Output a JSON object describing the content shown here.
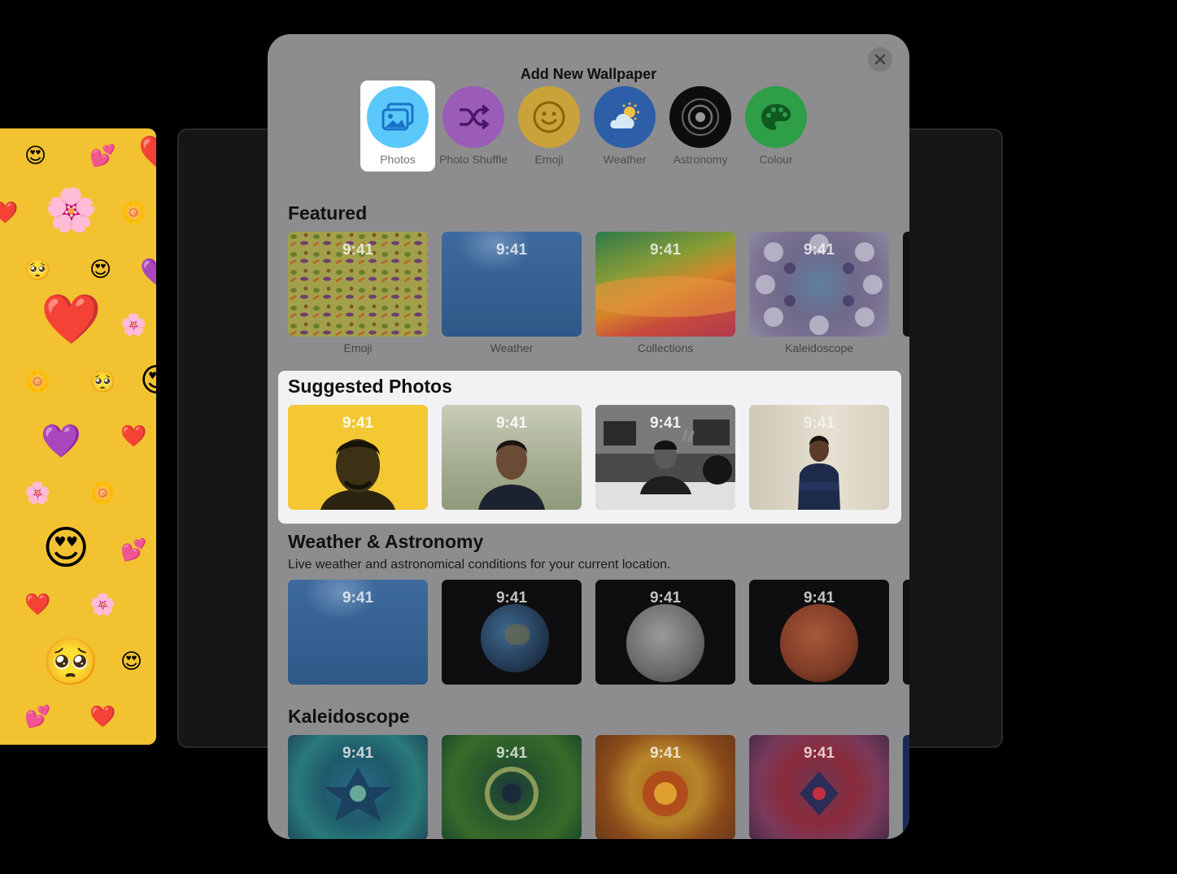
{
  "modal": {
    "title": "Add New Wallpaper",
    "close_icon": "close-icon"
  },
  "categories": [
    {
      "label": "Photos",
      "icon": "photos-icon",
      "color": "#5ac8fa",
      "selected": true
    },
    {
      "label": "Photo Shuffle",
      "icon": "shuffle-icon",
      "color": "#9b59b6",
      "selected": false
    },
    {
      "label": "Emoji",
      "icon": "emoji-icon",
      "color": "#f5c542",
      "selected": false
    },
    {
      "label": "Weather",
      "icon": "weather-icon",
      "color": "#2f6fd6",
      "selected": false
    },
    {
      "label": "Astronomy",
      "icon": "astronomy-icon",
      "color": "#111111",
      "selected": false
    },
    {
      "label": "Colour",
      "icon": "palette-icon",
      "color": "#34c759",
      "selected": false
    }
  ],
  "featured": {
    "title": "Featured",
    "items": [
      {
        "label": "Emoji",
        "time": "9:41"
      },
      {
        "label": "Weather",
        "time": "9:41"
      },
      {
        "label": "Collections",
        "time": "9:41"
      },
      {
        "label": "Kaleidoscope",
        "time": "9:41"
      }
    ]
  },
  "suggested": {
    "title": "Suggested Photos",
    "items": [
      {
        "time": "9:41"
      },
      {
        "time": "9:41"
      },
      {
        "time": "9:41"
      },
      {
        "time": "9:41"
      }
    ]
  },
  "weather_astronomy": {
    "title": "Weather & Astronomy",
    "subtitle": "Live weather and astronomical conditions for your current location.",
    "items": [
      {
        "time": "9:41"
      },
      {
        "time": "9:41"
      },
      {
        "time": "9:41"
      },
      {
        "time": "9:41"
      }
    ]
  },
  "kaleidoscope": {
    "title": "Kaleidoscope",
    "items": [
      {
        "time": "9:41"
      },
      {
        "time": "9:41"
      },
      {
        "time": "9:41"
      },
      {
        "time": "9:41"
      }
    ]
  }
}
